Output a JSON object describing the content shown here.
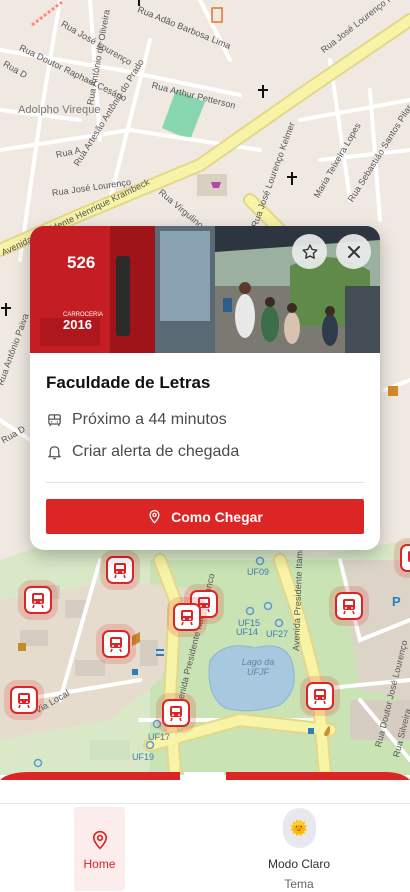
{
  "map": {
    "streets": [
      "Rua Adão Barbosa Lima",
      "Rua José Lourenço",
      "Rua José Lourenço Kelmer",
      "Rua Doutor Raphael Cesário",
      "Rua Antônio de Oliveira",
      "Rua Arthur Petterson",
      "Rua D",
      "Adolpho Vireque",
      "Rua Artesão Antônio do Prado",
      "Rua A",
      "Rua José Lourenço",
      "Avenida Presidente Henrique Krambeck",
      "Rua Virgulino",
      "Rua José Lourenço Kelmer",
      "Maria Teixeira Lopes",
      "Rua Sebastião Santos Pilar",
      "Rua Antônio Paiva",
      "Rua D",
      "Via Local",
      "Avenida Presidente Itamar Franco",
      "Avenida Presidente Itamar Franco",
      "Rua Doutor José Lourenço",
      "Rua Silveira"
    ],
    "campus_labels": [
      "UF09",
      "UF15",
      "UF14",
      "UF27",
      "UF17",
      "UF19"
    ],
    "lake_label": "Lago da UFJF"
  },
  "card": {
    "bus_number": "526",
    "bus_caption": "CARROCERIA",
    "bus_year": "2016",
    "title": "Faculdade de Letras",
    "arrival": "Próximo a 44 minutos",
    "alert": "Criar alerta de chegada",
    "cta": "Como Chegar"
  },
  "nav": {
    "home_label": "Home",
    "theme_label": "Modo Claro",
    "theme_sub": "Tema",
    "theme_emoji": "🌞"
  },
  "colors": {
    "primary": "#dc2626",
    "map_land": "#efe9e1",
    "map_park": "#c9e3b4",
    "water": "#a8c8e0",
    "major_road": "#f7f3a7"
  }
}
